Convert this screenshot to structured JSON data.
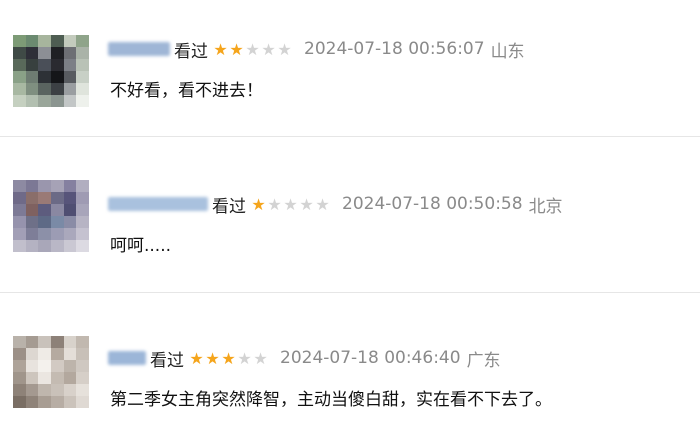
{
  "reviews": [
    {
      "watched": "看过",
      "rating": 2,
      "time": "2024-07-18 00:56:07",
      "location": "山东",
      "content": "不好看，看不进去！",
      "colors": {
        "name_blur": "#9fb6d6",
        "avatar": [
          "#7d9b76",
          "#6b8a70",
          "#a7b59d",
          "#4e5d52",
          "#c3cbbd",
          "#8fa48a",
          "#3f4a46",
          "#2e2f38",
          "#8c8f95",
          "#1f2024",
          "#6d6f74",
          "#aab3a8",
          "#59695a",
          "#38403f",
          "#4a4f58",
          "#2a2a30",
          "#7c7f86",
          "#b9c2b6",
          "#8aa187",
          "#6e7c72",
          "#2d3136",
          "#151619",
          "#585b60",
          "#c8d0c6",
          "#a8b8a2",
          "#7f8f80",
          "#5a6460",
          "#3c4044",
          "#9a9ea1",
          "#dfe4dc",
          "#c5d0c0",
          "#b2bfb0",
          "#9aa69a",
          "#8b9590",
          "#c2c6c6",
          "#eef1ec"
        ]
      }
    },
    {
      "watched": "看过",
      "rating": 1,
      "time": "2024-07-18 00:50:58",
      "location": "北京",
      "content": "呵呵.....",
      "colors": {
        "name_blur": "#a9c1de",
        "avatar": [
          "#8d8aa2",
          "#7c7895",
          "#9a96ad",
          "#a6a2b6",
          "#8580a0",
          "#b1aec0",
          "#6f6a88",
          "#8a6e6a",
          "#9a7a76",
          "#6b6a86",
          "#57547a",
          "#9f9bb3",
          "#7d7a96",
          "#7f6160",
          "#5d5c7e",
          "#8a88a2",
          "#4f4e72",
          "#a8a5ba",
          "#9693ad",
          "#6e7088",
          "#5e6a86",
          "#7a8aa6",
          "#8a8ca6",
          "#b7b4c4",
          "#a29fb6",
          "#7e7e98",
          "#8c90a8",
          "#9c9cb4",
          "#aaa8bc",
          "#c5c2d0",
          "#c1bfcc",
          "#b4b2c2",
          "#a9a7b9",
          "#b9b7c6",
          "#cac8d3",
          "#dcdae2"
        ]
      }
    },
    {
      "watched": "看过",
      "rating": 3,
      "time": "2024-07-18 00:46:40",
      "location": "广东",
      "content": "第二季女主角突然降智，主动当傻白甜，实在看不下去了。",
      "colors": {
        "name_blur": "#9cb6d8",
        "avatar": [
          "#b9b2aa",
          "#a59b92",
          "#c9c2bb",
          "#8d8178",
          "#d8d2cb",
          "#c1b8af",
          "#9c9087",
          "#ddd7d1",
          "#efebe6",
          "#b5aaa0",
          "#e4ded8",
          "#c8c0b8",
          "#aea399",
          "#e8e3de",
          "#f4f1ed",
          "#d2cac3",
          "#bdb4ab",
          "#cfc8c1",
          "#a0958b",
          "#cdc5bd",
          "#ebe6e1",
          "#c4bbb2",
          "#b3a89e",
          "#d6cfc8",
          "#8e8278",
          "#a49990",
          "#bfb6ad",
          "#c9c1b9",
          "#d8d1ca",
          "#e6e1db",
          "#7a6e64",
          "#8f8379",
          "#a89d93",
          "#b7ada4",
          "#cbc3bb",
          "#dfd9d3"
        ]
      }
    }
  ]
}
